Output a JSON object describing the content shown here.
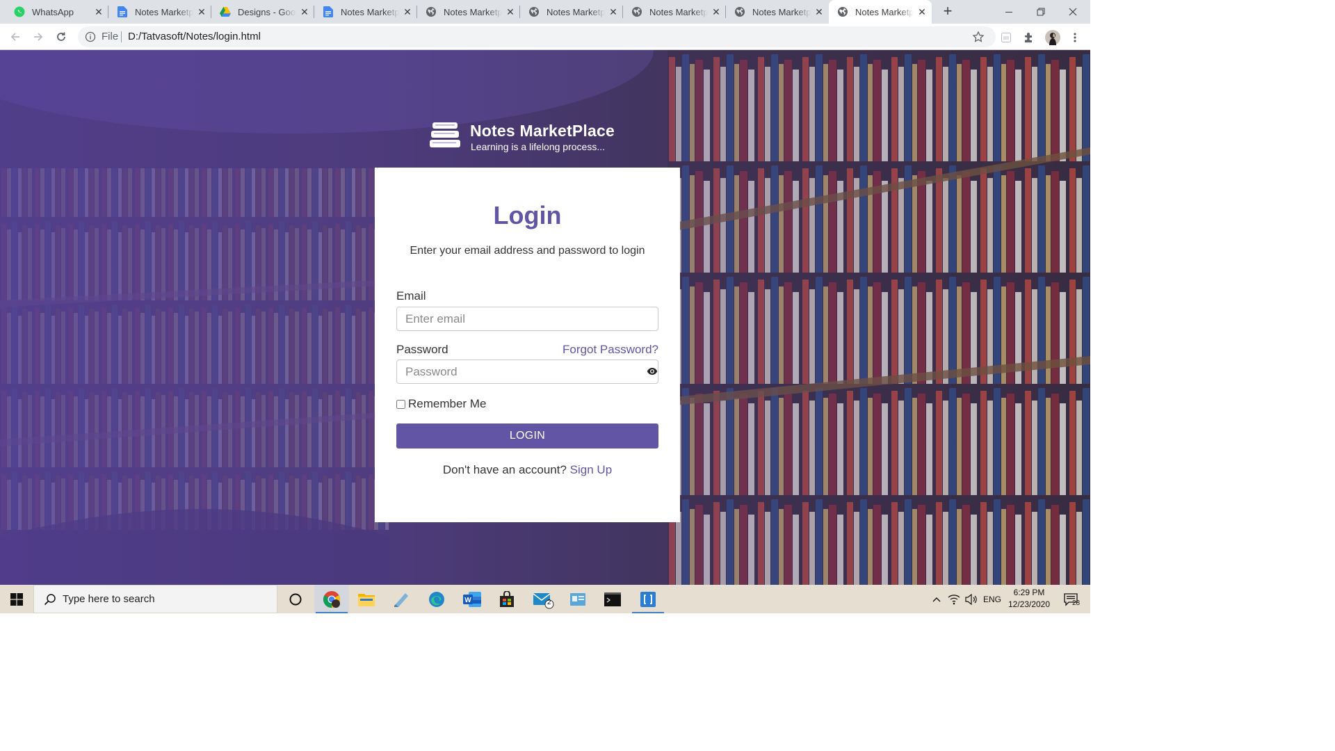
{
  "browser": {
    "tabs": [
      {
        "title": "WhatsApp",
        "icon": "whatsapp-icon"
      },
      {
        "title": "Notes Marketplace",
        "icon": "google-docs-icon"
      },
      {
        "title": "Designs - Google Drive",
        "icon": "google-drive-icon"
      },
      {
        "title": "Notes Marketplace",
        "icon": "google-docs-icon"
      },
      {
        "title": "Notes Marketplace",
        "icon": "globe-icon"
      },
      {
        "title": "Notes Marketplace",
        "icon": "globe-icon"
      },
      {
        "title": "Notes Marketplace",
        "icon": "globe-icon"
      },
      {
        "title": "Notes Marketplace",
        "icon": "globe-icon"
      },
      {
        "title": "Notes Marketplace",
        "icon": "globe-icon",
        "active": true
      }
    ],
    "address": {
      "scheme": "File",
      "url": "D:/Tatvasoft/Notes/login.html"
    }
  },
  "page": {
    "brand": "Notes MarketPlace",
    "tagline": "Learning is a lifelong process...",
    "login": {
      "title": "Login",
      "subtitle": "Enter your email address and password to login",
      "email_label": "Email",
      "email_placeholder": "Enter email",
      "password_label": "Password",
      "password_placeholder": "Password",
      "forgot": "Forgot Password?",
      "remember": "Remember Me",
      "button": "LOGIN",
      "signup_prompt": "Don't have an account?",
      "signup_link": "Sign Up"
    }
  },
  "taskbar": {
    "search_placeholder": "Type here to search",
    "mail_badge": "2",
    "lang": "ENG",
    "time": "6:29 PM",
    "date": "12/23/2020",
    "notifications": "28"
  },
  "colors": {
    "accent": "#6255a5",
    "overlay": "#5842a0"
  }
}
